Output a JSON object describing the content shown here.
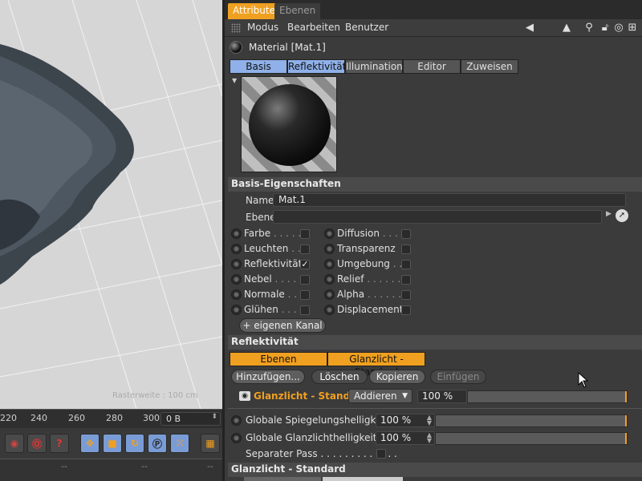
{
  "viewport": {
    "grid_label": "Rasterweite : 100 cm",
    "timeline_ticks": [
      "220",
      "240",
      "260",
      "280",
      "300"
    ],
    "bytes_value": "0 B",
    "transport_icons": [
      "record-icon",
      "autokey-icon",
      "help-icon",
      "move-icon",
      "scale-icon",
      "rotate-icon",
      "p-icon",
      "dots-icon",
      "film-icon"
    ],
    "status_dashes": [
      "--",
      "--",
      "--"
    ]
  },
  "panel": {
    "tabs": [
      "Attribute",
      "Ebenen"
    ],
    "menu": [
      "Modus",
      "Bearbeiten",
      "Benutzer"
    ],
    "object_title": "Material [Mat.1]",
    "subtabs": [
      "Basis",
      "Reflektivität",
      "Illumination",
      "Editor",
      "Zuweisen"
    ],
    "basis_section": "Basis-Eigenschaften",
    "name_label": "Name",
    "name_value": "Mat.1",
    "layer_label": "Ebene",
    "channels_left": [
      {
        "label": "Farbe",
        "dots": " . . . . .",
        "checked": false
      },
      {
        "label": "Leuchten",
        "dots": " . .",
        "checked": false
      },
      {
        "label": "Reflektivität",
        "dots": "",
        "checked": true
      },
      {
        "label": "Nebel",
        "dots": " . . . . .",
        "checked": false
      },
      {
        "label": "Normale",
        "dots": " . .",
        "checked": false
      },
      {
        "label": "Glühen",
        "dots": " . . . .",
        "checked": false
      }
    ],
    "channels_right": [
      {
        "label": "Diffusion",
        "dots": " . . . .",
        "checked": false
      },
      {
        "label": "Transparenz",
        "dots": "",
        "checked": false
      },
      {
        "label": "Umgebung",
        "dots": " . .",
        "checked": false
      },
      {
        "label": "Relief",
        "dots": " . . . . . . .",
        "checked": false
      },
      {
        "label": "Alpha",
        "dots": " . . . . . . .",
        "checked": false
      },
      {
        "label": "Displacement",
        "dots": "",
        "checked": false
      }
    ],
    "add_channel_button": "+ eigenen Kanal",
    "refl_section": "Reflektivität",
    "layer_tabs": [
      "Ebenen",
      "Glanzlicht - Standard"
    ],
    "layer_buttons": [
      "Hinzufügen...",
      "Löschen",
      "Kopieren",
      "Einfügen"
    ],
    "layer_row": {
      "name": "Glanzlicht - Standard",
      "blend_mode": "Addieren",
      "opacity": "100 %"
    },
    "global_refl_label": "Globale Spiegelungshelligkeit",
    "global_refl_value": "100 %",
    "global_spec_label": "Globale Glanzlichthelligkeit . .",
    "global_spec_value": "100 %",
    "separate_pass_label": "Separater Pass . . . . . . . . . . . . .",
    "bottom_section": "Glanzlicht - Standard",
    "accent_color": "#f0a020",
    "tab_highlight_color": "#8fb0e8"
  }
}
